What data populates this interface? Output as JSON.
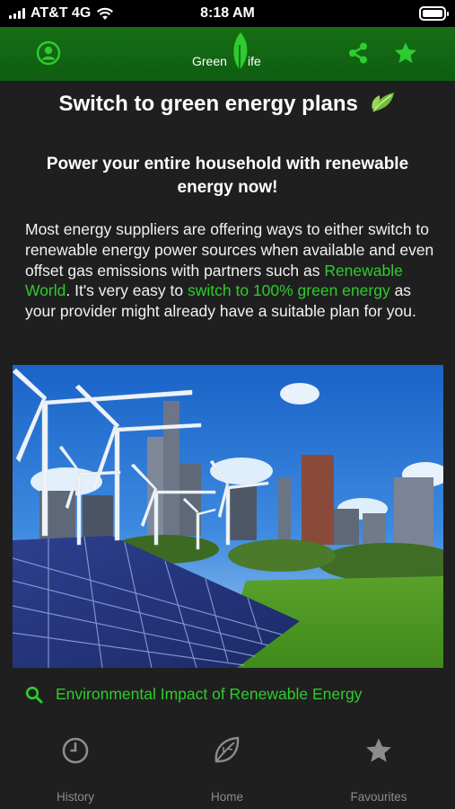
{
  "status_bar": {
    "carrier": "AT&T 4G",
    "time": "8:18 AM",
    "battery_level": 1.0
  },
  "header": {
    "logo_text_left": "Green",
    "logo_text_right": "ife",
    "profile_icon": "user-circle-icon",
    "share_icon": "share-icon",
    "favourite_icon": "star-icon",
    "accent_color": "#156f15"
  },
  "article": {
    "title": "Switch to green energy plans",
    "subtitle": "Power your entire household with renewable energy now!",
    "body_part1": "Most energy suppliers are offering ways to either switch to renewable energy power sources when available and even offset gas emissions with partners such as ",
    "link1": "Renewable World",
    "body_part2": ". It's very easy to ",
    "link2": "switch to 100% green energy",
    "body_part3": " as your provider might already have a suitable plan for you.",
    "link_color": "#2ecc2e"
  },
  "related": {
    "label": "Environmental Impact of Renewable Energy",
    "icon": "search-icon"
  },
  "bottom_nav": {
    "items": [
      {
        "label": "History",
        "icon": "clock-icon"
      },
      {
        "label": "Home",
        "icon": "leaf-icon"
      },
      {
        "label": "Favourites",
        "icon": "star-icon"
      }
    ]
  }
}
